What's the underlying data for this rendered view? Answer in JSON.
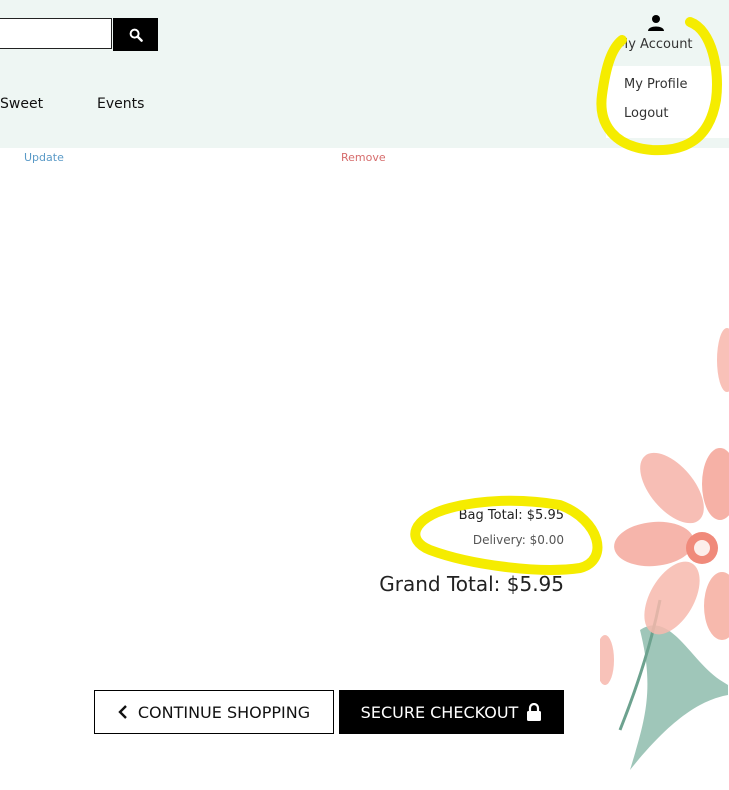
{
  "header": {
    "search": {
      "value": "",
      "placeholder": ""
    },
    "search_icon": "search-icon",
    "nav": [
      "Sweet",
      "Events"
    ],
    "account": {
      "icon": "user-icon",
      "label": "My Account",
      "menu": [
        "My Profile",
        "Logout"
      ]
    }
  },
  "cart": {
    "update_label": "Update",
    "remove_label": "Remove"
  },
  "totals": {
    "bag_total": "Bag Total: $5.95",
    "delivery": "Delivery: $0.00",
    "grand_total": "Grand Total: $5.95"
  },
  "actions": {
    "continue_label": "CONTINUE SHOPPING",
    "checkout_label": "SECURE CHECKOUT",
    "continue_icon": "chevron-left-icon",
    "checkout_icon": "lock-icon"
  },
  "colors": {
    "header_bg": "#eef6f3",
    "highlight": "#f5ec00",
    "link_update": "#5a9ac7",
    "link_remove": "#d66c6c"
  }
}
